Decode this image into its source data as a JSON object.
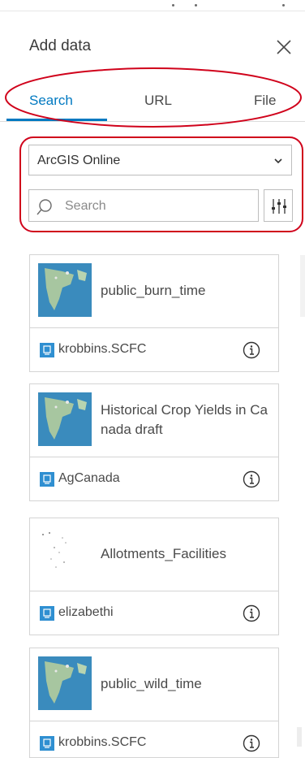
{
  "panel": {
    "title": "Add data",
    "close_icon": "close-icon"
  },
  "tabs": [
    {
      "label": "Search",
      "active": true
    },
    {
      "label": "URL",
      "active": false
    },
    {
      "label": "File",
      "active": false
    }
  ],
  "source_select": {
    "value": "ArcGIS Online",
    "icon": "chevron-down-icon"
  },
  "search": {
    "placeholder": "Search",
    "value": "",
    "icon": "search-icon",
    "filter_icon": "filter-sliders-icon"
  },
  "results": [
    {
      "name": "public_burn_time",
      "owner": "krobbins.SCFC",
      "thumbnail": "map-thumbnail-icon",
      "owner_icon": "content-icon",
      "info_icon": "info-icon"
    },
    {
      "name": "Historical Crop Yields in Canada draft",
      "owner": "AgCanada",
      "thumbnail": "map-thumbnail-icon",
      "owner_icon": "content-icon",
      "info_icon": "info-icon"
    },
    {
      "name": "Allotments_Facilities",
      "owner": "elizabethi",
      "thumbnail": "dots-thumbnail-icon",
      "owner_icon": "content-icon",
      "info_icon": "info-icon"
    },
    {
      "name": "public_wild_time",
      "owner": "krobbins.SCFC",
      "thumbnail": "map-thumbnail-icon",
      "owner_icon": "content-icon",
      "info_icon": "info-icon"
    }
  ],
  "colors": {
    "accent": "#0079c1",
    "annotation": "#d0021b",
    "border": "#bdbdbd"
  }
}
